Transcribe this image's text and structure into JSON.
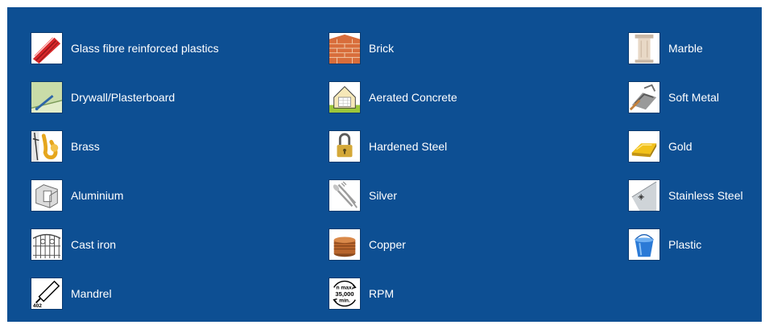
{
  "materials": [
    {
      "label": "Glass fibre reinforced plastics",
      "icon": "glass-fibre-pipe-icon"
    },
    {
      "label": "Brick",
      "icon": "brick-wall-icon"
    },
    {
      "label": "Marble",
      "icon": "marble-column-icon"
    },
    {
      "label": "Drywall/Plasterboard",
      "icon": "plasterboard-icon"
    },
    {
      "label": "Aerated Concrete",
      "icon": "aerated-concrete-house-icon"
    },
    {
      "label": "Soft Metal",
      "icon": "soft-metal-icon"
    },
    {
      "label": "Brass",
      "icon": "saxophone-icon"
    },
    {
      "label": "Hardened Steel",
      "icon": "padlock-icon"
    },
    {
      "label": "Gold",
      "icon": "gold-bar-icon"
    },
    {
      "label": "Aluminium",
      "icon": "aluminium-profile-icon"
    },
    {
      "label": "Silver",
      "icon": "cutlery-icon"
    },
    {
      "label": "Stainless Steel",
      "icon": "steel-sheet-icon"
    },
    {
      "label": "Cast iron",
      "icon": "cast-iron-gate-icon"
    },
    {
      "label": "Copper",
      "icon": "copper-coins-icon"
    },
    {
      "label": "Plastic",
      "icon": "plastic-bucket-icon"
    },
    {
      "label": "Mandrel",
      "icon": "mandrel-icon",
      "icon_text": "402"
    },
    {
      "label": "RPM",
      "icon": "rpm-icon",
      "icon_text": [
        "n max.",
        "35,000",
        "min."
      ]
    }
  ],
  "colors": {
    "panel": "#0d4f93",
    "text": "#ffffff"
  }
}
